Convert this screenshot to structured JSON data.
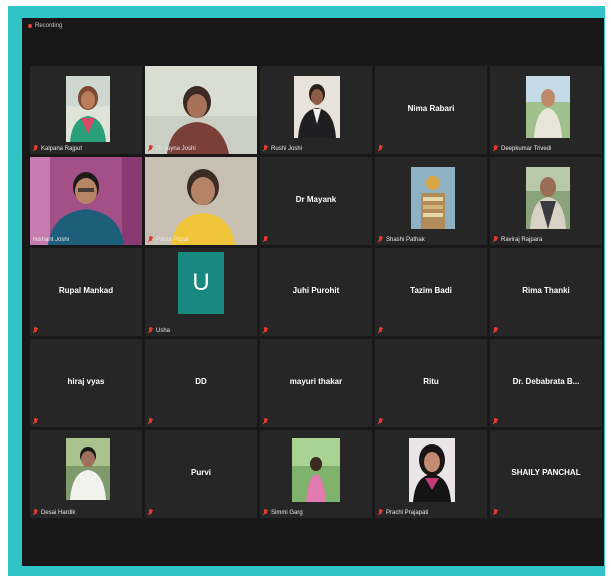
{
  "recording_label": "Recording",
  "participants": [
    {
      "name": "Kalpana Rajput"
    },
    {
      "name": "Dr Jayna Joshi"
    },
    {
      "name": "Rushi Joshi"
    },
    {
      "name": "Nima Rabari"
    },
    {
      "name": "Deepkumar Trivedi"
    },
    {
      "name": "Nishant Joshi"
    },
    {
      "name": "Panul Popat"
    },
    {
      "name": "Dr Mayank"
    },
    {
      "name": "Shashi Pathak"
    },
    {
      "name": "Raviraj Rajpara"
    },
    {
      "name": "Rupal Mankad"
    },
    {
      "name": "Usha",
      "initial": "U"
    },
    {
      "name": "Juhi Purohit"
    },
    {
      "name": "Tazim Badi"
    },
    {
      "name": "Rima Thanki"
    },
    {
      "name": "hiraj vyas"
    },
    {
      "name": "DD"
    },
    {
      "name": "mayuri thakar"
    },
    {
      "name": "Ritu"
    },
    {
      "name": "Dr. Debabrata B..."
    },
    {
      "name": "Desai Hardik"
    },
    {
      "name": "Purvi"
    },
    {
      "name": "Simmi Garg"
    },
    {
      "name": "Prachi Prajapati"
    },
    {
      "name": "SHAILY PANCHAL"
    }
  ],
  "colors": {
    "border_accent": "#30c4c7",
    "active_speaker": "#d6e25a",
    "muted_mic": "#e43a2f",
    "avatar_usha": "#17897e"
  }
}
